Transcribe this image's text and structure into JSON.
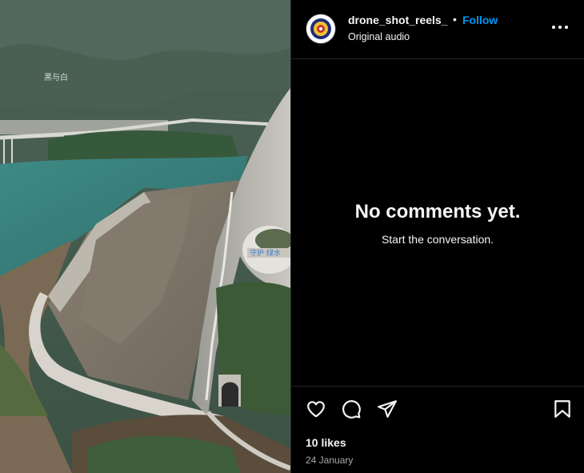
{
  "media": {
    "watermark": "黑与白"
  },
  "post": {
    "username": "drone_shot_reels_",
    "separator": "•",
    "follow_label": "Follow",
    "audio": "Original audio"
  },
  "comments": {
    "empty_title": "No comments yet.",
    "empty_subtitle": "Start the conversation."
  },
  "stats": {
    "likes": "10 likes",
    "date": "24 January"
  },
  "icons": {
    "like": "heart-icon",
    "comment": "comment-bubble-icon",
    "share": "paper-plane-icon",
    "save": "bookmark-icon",
    "more": "more-options-icon"
  },
  "colors": {
    "accent": "#0095f6",
    "background": "#000000",
    "text": "#f5f5f5",
    "secondary_text": "#a8a8a8"
  }
}
